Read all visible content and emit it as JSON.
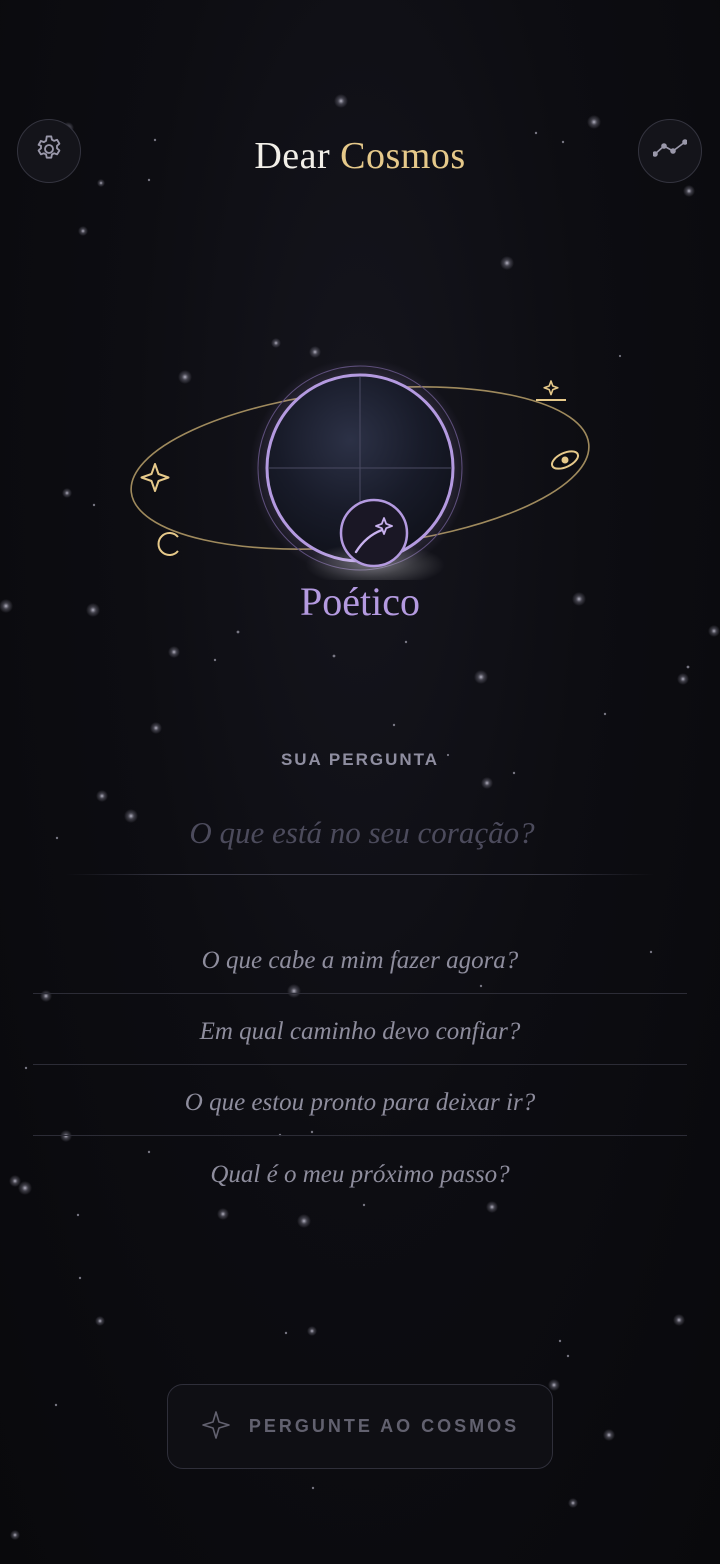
{
  "header": {
    "title_part1": "Dear",
    "title_part2": "Cosmos",
    "settings_icon": "gear-icon",
    "stats_icon": "trend-line-icon"
  },
  "mode": {
    "label": "Poético",
    "accent_color": "#b49ae0",
    "gold_color": "#e6c98a"
  },
  "question": {
    "section_label": "SUA PERGUNTA",
    "placeholder": "O que está no seu coração?",
    "value": ""
  },
  "suggestions": [
    "O que cabe a mim fazer agora?",
    "Em qual caminho devo confiar?",
    "O que estou pronto para deixar ir?",
    "Qual é o meu próximo passo?"
  ],
  "ask_button": {
    "label": "PERGUNTE AO COSMOS",
    "icon": "sparkle-icon"
  }
}
